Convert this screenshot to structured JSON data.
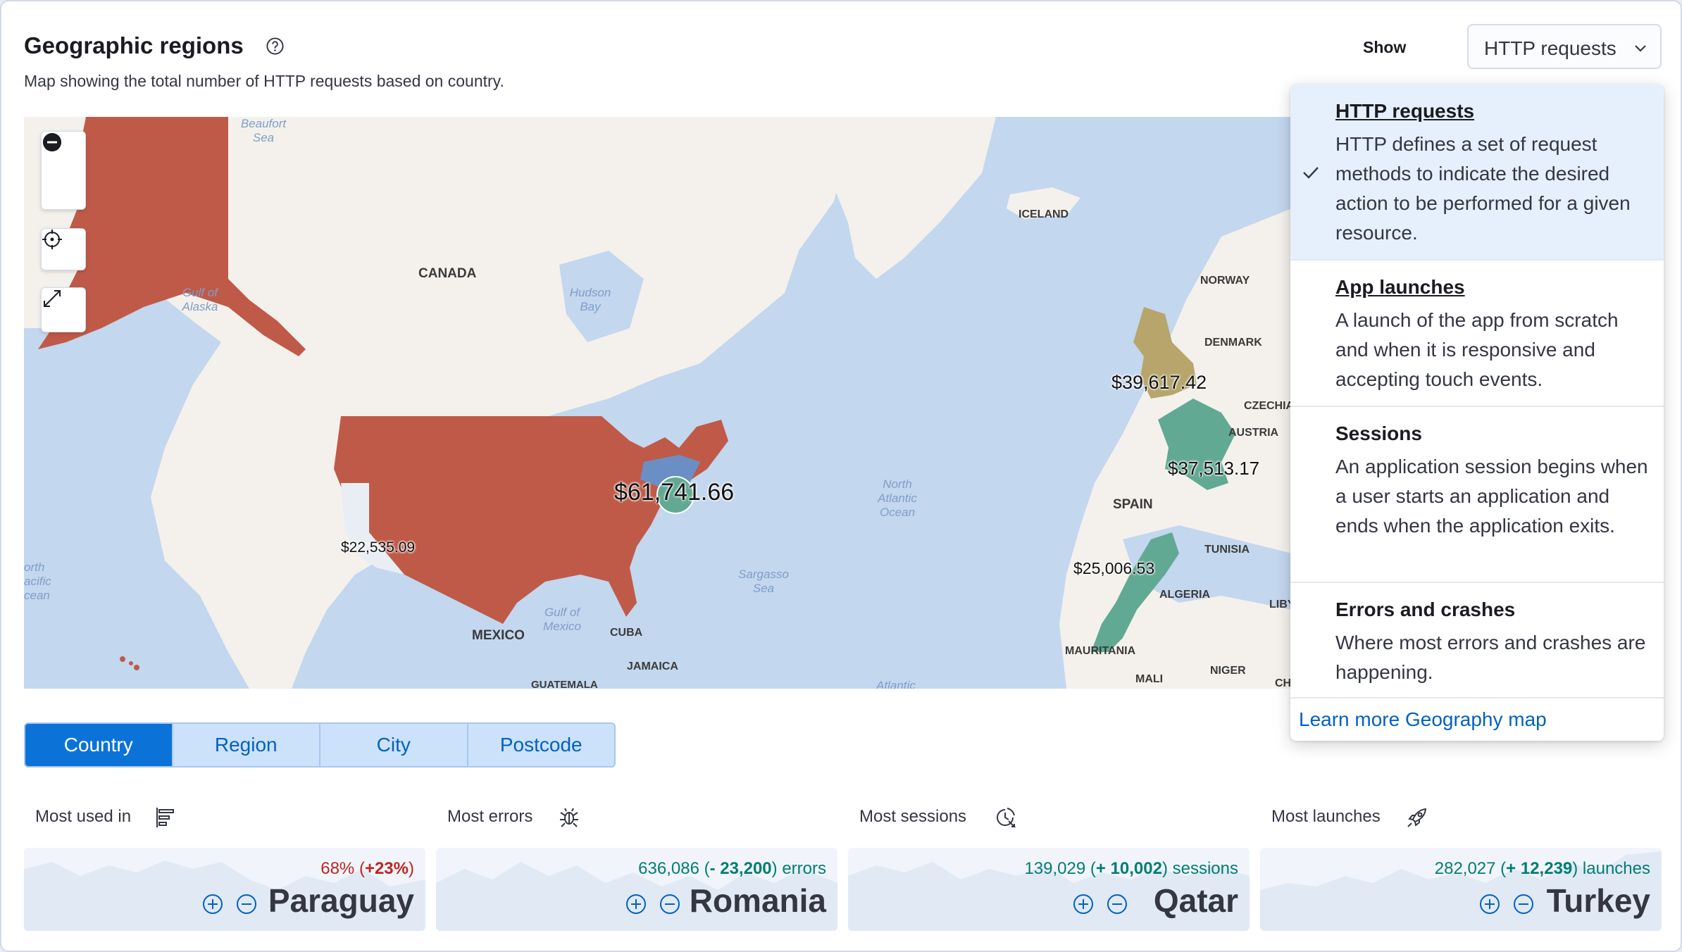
{
  "header": {
    "title": "Geographic regions",
    "subtitle": "Map showing the total number of  HTTP requests based on country.",
    "show_label": "Show",
    "select_value": "HTTP requests"
  },
  "map": {
    "labels": {
      "canada": "CANADA",
      "mexico": "MEXICO",
      "cuba": "CUBA",
      "jamaica": "JAMAICA",
      "guatemala": "GUATEMALA",
      "iceland": "ICELAND",
      "norway": "NORWAY",
      "denmark": "DENMARK",
      "czechia": "CZECHIA",
      "austria": "AUSTRIA",
      "spain": "SPAIN",
      "tunisia": "TUNISIA",
      "algeria": "ALGERIA",
      "libya": "LIBY",
      "mauritania": "MAURITANIA",
      "mali": "MALI",
      "niger": "NIGER",
      "chad": "CH",
      "beaufort": "Beaufort Sea",
      "gulf_alaska": "Gulf of Alaska",
      "hudson": "Hudson Bay",
      "north_atlantic": "North Atlantic Ocean",
      "sargasso": "Sargasso Sea",
      "gulf_mexico": "Gulf of Mexico",
      "north_pacific": "orth acific cean",
      "atlantic_bottom": "Atlantic"
    },
    "values": {
      "usa": "$61,741.66",
      "california": "$22,535.09",
      "uk": "$39,617.42",
      "france": "$37,513.17",
      "morocco": "$25,006.53"
    },
    "colors": {
      "water": "#c3d7ef",
      "land": "#f4f1ec",
      "high": "#c05a48",
      "mid_blue": "#6b8fc4",
      "teal": "#61a993",
      "olive": "#b7a56c"
    }
  },
  "segments": [
    {
      "label": "Country",
      "active": true
    },
    {
      "label": "Region",
      "active": false
    },
    {
      "label": "City",
      "active": false
    },
    {
      "label": "Postcode",
      "active": false
    }
  ],
  "stats": [
    {
      "label": "Most used in",
      "icon": "bar-list-icon",
      "change_value": "68% (+23%)",
      "change_suffix": "",
      "name": "Paraguay",
      "tone": "red"
    },
    {
      "label": "Most errors",
      "icon": "bug-icon",
      "change_value": "636,086 (- 23,200)",
      "change_suffix": " errors",
      "name": "Romania",
      "tone": "green"
    },
    {
      "label": "Most sessions",
      "icon": "clock-session-icon",
      "change_value": "139,029 (+ 10,002)",
      "change_suffix": " sessions",
      "name": "Qatar",
      "tone": "green"
    },
    {
      "label": "Most launches",
      "icon": "rocket-icon",
      "change_value": "282,027 (+ 12,239)",
      "change_suffix": " launches",
      "name": "Turkey",
      "tone": "green"
    }
  ],
  "stat_parts": [
    {
      "plain": "68% (",
      "bold": "+23%",
      "end": ")"
    },
    {
      "plain": "636,086 (",
      "bold": "- 23,200",
      "end": ") errors"
    },
    {
      "plain": "139,029 (",
      "bold": "+ 10,002",
      "end": ") sessions"
    },
    {
      "plain": "282,027 (",
      "bold": "+ 12,239",
      "end": ") launches"
    }
  ],
  "dropdown": {
    "options": [
      {
        "title": "HTTP requests",
        "desc": "HTTP defines a set of request methods to indicate the desired action to be performed for a given resource.",
        "selected": true
      },
      {
        "title": "App launches",
        "desc": "A launch of the app from scratch and when it is responsive and accepting touch events.",
        "selected": false
      },
      {
        "title": "Sessions",
        "desc": "An application session begins when a user starts an application and ends when the application exits.",
        "selected": false
      },
      {
        "title": "Errors and crashes",
        "desc": "Where most errors and crashes are happening.",
        "selected": false
      }
    ],
    "learn_more": "Learn more Geography map"
  }
}
